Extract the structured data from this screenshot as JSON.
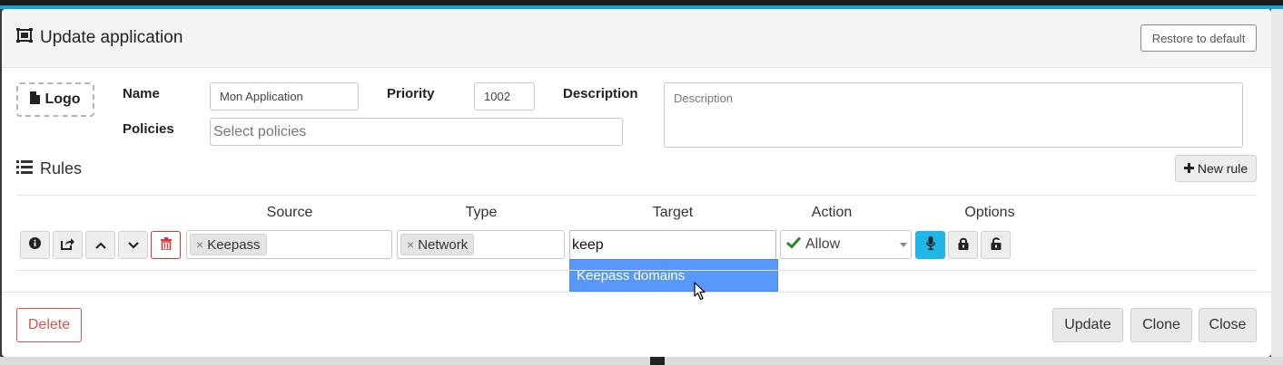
{
  "header": {
    "title": "Update application",
    "title_icon": "window-restore-icon",
    "restore_label": "Restore to default"
  },
  "app": {
    "logo_label": "Logo",
    "name_label": "Name",
    "name_value": "Mon Application",
    "priority_label": "Priority",
    "priority_value": "1002",
    "description_label": "Description",
    "description_placeholder": "Description",
    "policies_label": "Policies",
    "policies_placeholder": "Select policies"
  },
  "rules": {
    "title": "Rules",
    "new_rule_label": "New rule",
    "columns": {
      "source": "Source",
      "type": "Type",
      "target": "Target",
      "action": "Action",
      "options": "Options"
    },
    "row": {
      "source_tag": "Keepass",
      "type_tag": "Network",
      "target_search": "keep",
      "target_suggestion": "Keepass domains",
      "action_value": "Allow"
    }
  },
  "footer": {
    "delete_label": "Delete",
    "update_label": "Update",
    "clone_label": "Clone",
    "close_label": "Close"
  },
  "colors": {
    "accent_blue": "#5897fb",
    "danger": "#d9534f",
    "info": "#1fb6e8",
    "allow_green": "#1e8e1e"
  }
}
